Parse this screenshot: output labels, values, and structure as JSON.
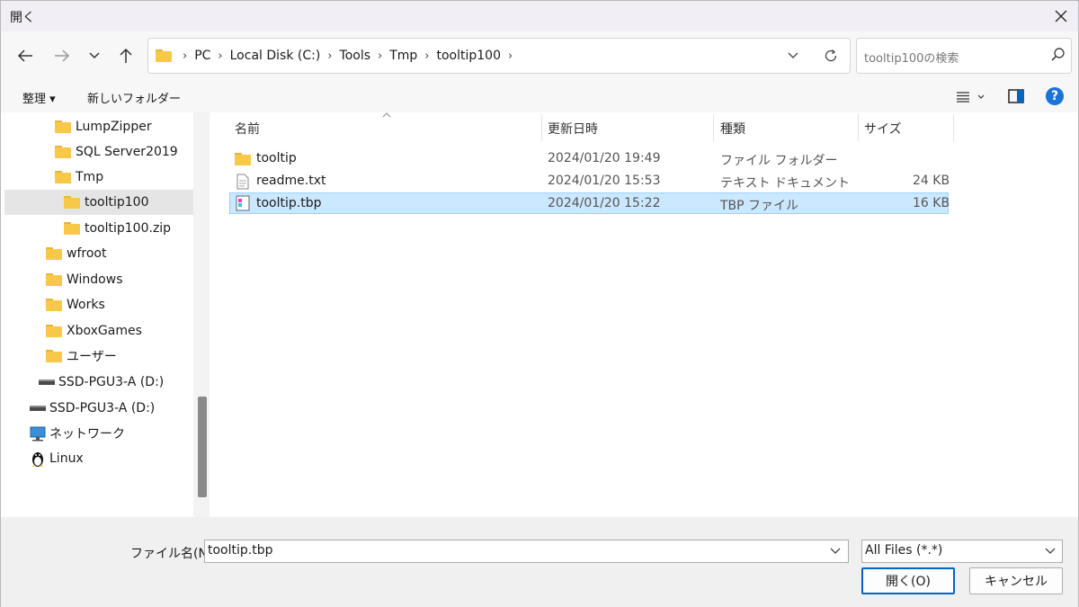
{
  "window": {
    "title": "開く"
  },
  "navigation": {
    "back": "←",
    "forward": "→",
    "recent": "⌄",
    "up": "↑"
  },
  "address": {
    "crumbs": [
      "PC",
      "Local Disk (C:)",
      "Tools",
      "Tmp",
      "tooltip100"
    ]
  },
  "search": {
    "placeholder": "tooltip100の検索"
  },
  "toolbar": {
    "organize": "整理 ▾",
    "new_folder": "新しいフォルダー"
  },
  "nav_tree": [
    {
      "label": "LumpZipper",
      "icon": "folder-icon"
    },
    {
      "label": "SQL Server2019",
      "icon": "folder-icon"
    },
    {
      "label": "Tmp",
      "icon": "folder-icon"
    },
    {
      "label": "tooltip100",
      "icon": "folder-icon",
      "selected": true
    },
    {
      "label": "tooltip100.zip",
      "icon": "zip-folder-icon"
    },
    {
      "label": "wfroot",
      "icon": "folder-icon"
    },
    {
      "label": "Windows",
      "icon": "folder-icon"
    },
    {
      "label": "Works",
      "icon": "folder-icon"
    },
    {
      "label": "XboxGames",
      "icon": "folder-icon"
    },
    {
      "label": "ユーザー",
      "icon": "folder-icon"
    },
    {
      "label": "SSD-PGU3-A (D:)",
      "icon": "drive-icon"
    },
    {
      "label": "SSD-PGU3-A (D:)",
      "icon": "drive-icon"
    },
    {
      "label": "ネットワーク",
      "icon": "network-icon"
    },
    {
      "label": "Linux",
      "icon": "linux-icon"
    }
  ],
  "columns": {
    "name": "名前",
    "modified": "更新日時",
    "type": "種類",
    "size": "サイズ"
  },
  "files": [
    {
      "name": "tooltip",
      "modified": "2024/01/20 19:49",
      "type": "ファイル フォルダー",
      "size": "",
      "icon": "folder-icon"
    },
    {
      "name": "readme.txt",
      "modified": "2024/01/20 15:53",
      "type": "テキスト ドキュメント",
      "size": "24 KB",
      "icon": "text-file-icon"
    },
    {
      "name": "tooltip.tbp",
      "modified": "2024/01/20 15:22",
      "type": "TBP ファイル",
      "size": "16 KB",
      "icon": "tbp-file-icon",
      "selected": true
    }
  ],
  "footer": {
    "filename_label": "ファイル名(N):",
    "filename_value": "tooltip.tbp",
    "filetype_value": "All Files (*.*)",
    "open_button": "開く(O)",
    "cancel_button": "キャンセル"
  },
  "colors": {
    "selection": "#cce8ff",
    "accent": "#0067c0",
    "folder": "#f8c848"
  }
}
